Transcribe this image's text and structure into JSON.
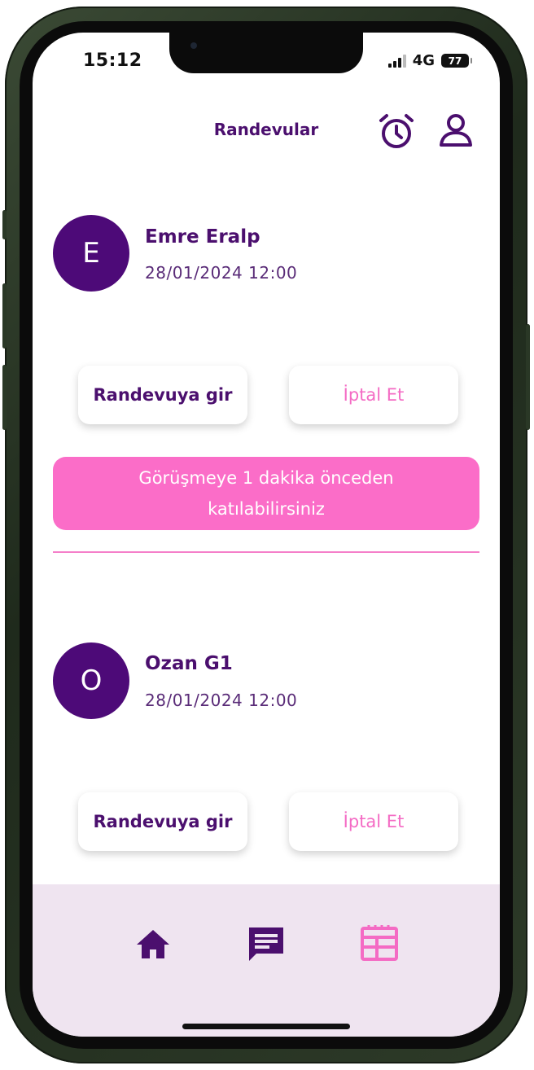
{
  "status_bar": {
    "time": "15:12",
    "network": "4G",
    "battery": "77"
  },
  "header": {
    "title": "Randevular",
    "alarm_icon": "alarm-clock-icon",
    "profile_icon": "user-icon"
  },
  "appointments": [
    {
      "initial": "E",
      "name": "Emre Eralp",
      "datetime": "28/01/2024 12:00",
      "enter_label": "Randevuya gir",
      "cancel_label": "İptal Et",
      "notice": "Görüşmeye 1 dakika önceden katılabilirsiniz"
    },
    {
      "initial": "O",
      "name": "Ozan G1",
      "datetime": "28/01/2024 12:00",
      "enter_label": "Randevuya gir",
      "cancel_label": "İptal Et"
    }
  ],
  "bottom_nav": {
    "items": [
      {
        "icon": "home-icon",
        "active": false
      },
      {
        "icon": "chat-icon",
        "active": false
      },
      {
        "icon": "calendar-icon",
        "active": true
      }
    ]
  },
  "colors": {
    "primary": "#4b0f6e",
    "avatar": "#4d0a78",
    "accent_pink": "#fb6dc8",
    "nav_background": "#efe4f0"
  }
}
